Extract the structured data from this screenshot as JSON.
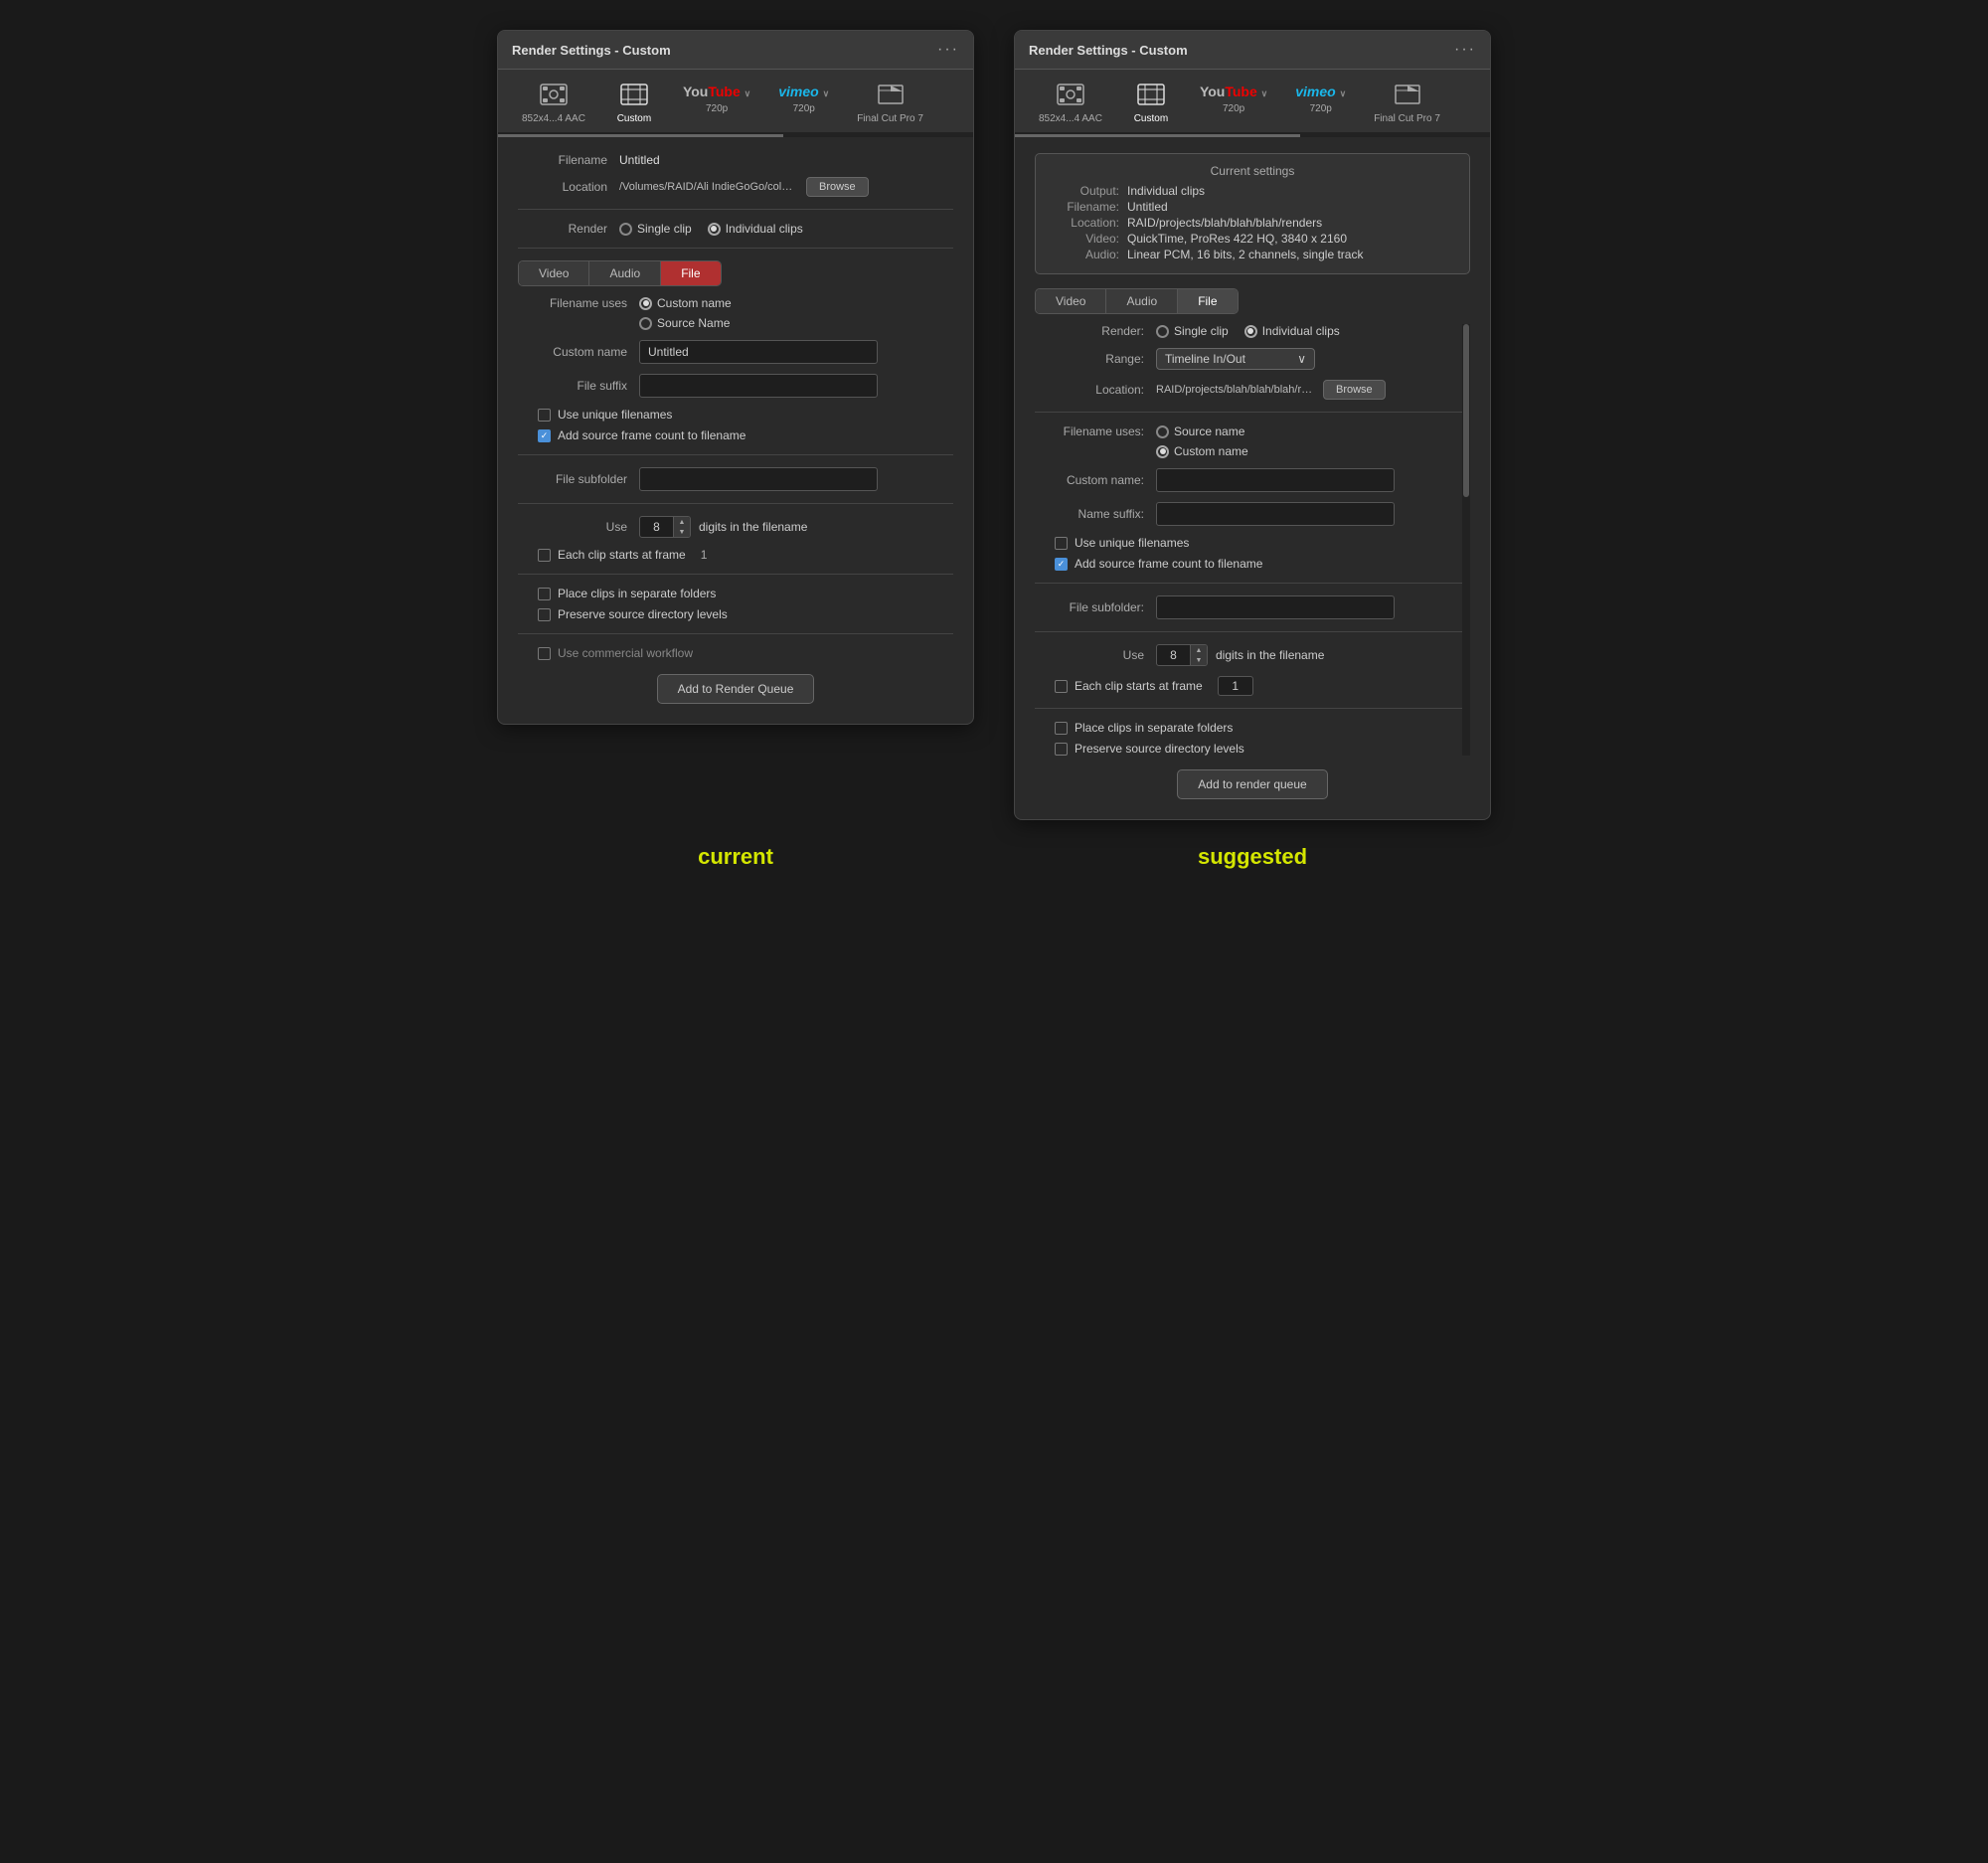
{
  "left_panel": {
    "title": "Render Settings - Custom",
    "filename_label": "Filename",
    "filename_value": "Untitled",
    "location_label": "Location",
    "location_value": "/Volumes/RAID/Ali IndieGoGo/color correctec",
    "browse_label": "Browse",
    "render_label": "Render",
    "render_single": "Single clip",
    "render_individual": "Individual clips",
    "tabs": [
      "Video",
      "Audio",
      "File"
    ],
    "active_tab": "File",
    "filename_uses_label": "Filename uses",
    "custom_name_radio": "Custom name",
    "source_name_radio": "Source Name",
    "custom_name_label": "Custom name",
    "custom_name_value": "Untitled",
    "file_suffix_label": "File suffix",
    "file_suffix_value": "",
    "use_unique_filenames": "Use unique filenames",
    "use_unique_checked": false,
    "add_source_frame": "Add source frame count to filename",
    "add_source_checked": true,
    "file_subfolder_label": "File subfolder",
    "file_subfolder_value": "",
    "use_label": "Use",
    "digits_value": "8",
    "digits_label": "digits in the filename",
    "each_clip_label": "Each clip starts at frame",
    "each_clip_checked": false,
    "each_clip_value": "1",
    "place_clips": "Place clips in separate folders",
    "place_clips_checked": false,
    "preserve_source": "Preserve source directory levels",
    "preserve_checked": false,
    "use_commercial": "Use commercial workflow",
    "add_queue_label": "Add to Render Queue",
    "toolbar": [
      {
        "icon": "⊞",
        "label": "852x4...4 AAC"
      },
      {
        "icon": "▦",
        "label": "Custom",
        "active": true
      },
      {
        "icon": "YT",
        "label": "720p"
      },
      {
        "icon": "VM",
        "label": "720p"
      },
      {
        "icon": "🎬",
        "label": "Final Cut Pro 7"
      }
    ]
  },
  "right_panel": {
    "title": "Render Settings - Custom",
    "current_settings_title": "Current settings",
    "output_label": "Output:",
    "output_value": "Individual clips",
    "filename_label": "Filename:",
    "filename_value": "Untitled",
    "location_label": "Location:",
    "location_value": "RAID/projects/blah/blah/blah/renders",
    "video_label": "Video:",
    "video_value": "QuickTime, ProRes 422 HQ, 3840 x 2160",
    "audio_label": "Audio:",
    "audio_value": "Linear PCM, 16 bits, 2 channels, single track",
    "tabs": [
      "Video",
      "Audio",
      "File"
    ],
    "active_tab": "File",
    "render_label": "Render:",
    "render_single": "Single clip",
    "render_individual": "Individual clips",
    "range_label": "Range:",
    "range_value": "Timeline In/Out",
    "location2_label": "Location:",
    "location2_value": "RAID/projects/blah/blah/blah/renders",
    "browse_label": "Browse",
    "filename_uses_label": "Filename uses:",
    "source_name_radio": "Source name",
    "custom_name_radio": "Custom name",
    "custom_name_label": "Custom name:",
    "custom_name_value": "",
    "name_suffix_label": "Name suffix:",
    "name_suffix_value": "",
    "use_unique_filenames": "Use unique filenames",
    "use_unique_checked": false,
    "add_source_frame": "Add source frame count to filename",
    "add_source_checked": true,
    "file_subfolder_label": "File subfolder:",
    "file_subfolder_value": "",
    "use_label": "Use",
    "digits_value": "8",
    "digits_label": "digits in the filename",
    "each_clip_label": "Each clip starts at frame",
    "each_clip_checked": false,
    "each_clip_value": "1",
    "place_clips": "Place clips in separate folders",
    "place_clips_checked": false,
    "preserve_source": "Preserve source directory levels",
    "preserve_checked": false,
    "add_queue_label": "Add to render queue"
  },
  "labels": {
    "current": "current",
    "suggested": "suggested"
  }
}
